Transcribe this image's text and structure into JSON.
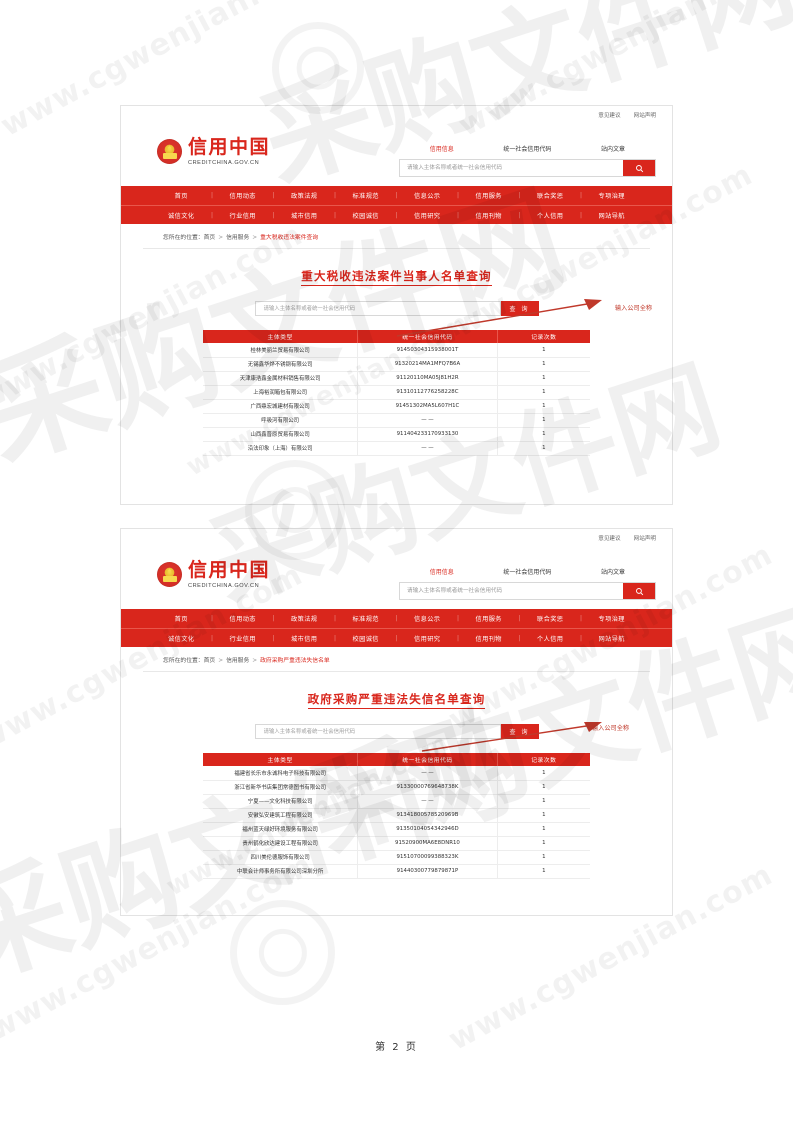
{
  "site": {
    "top_links": [
      "意见建议",
      "网站声明"
    ],
    "brand_cn": "信用中国",
    "brand_en": "CREDITCHINA.GOV.CN",
    "emblem_icon": "national-emblem-icon",
    "search": {
      "tabs": [
        "信用信息",
        "统一社会信用代码",
        "站内文章"
      ],
      "active_tab": "信用信息",
      "placeholder": "请输入主体名称或者统一社会信用代码",
      "button_icon": "search-icon"
    },
    "nav_row1": [
      "首页",
      "信用动态",
      "政策法规",
      "标准规范",
      "信息公示",
      "信用服务",
      "联合奖惩",
      "专项治理"
    ],
    "nav_row2": [
      "诚信文化",
      "行业信用",
      "城市信用",
      "校园诚信",
      "信用研究",
      "信用刊物",
      "个人信用",
      "网站导航"
    ]
  },
  "section1": {
    "breadcrumb": {
      "prefix": "您所在的位置：",
      "items": [
        "首页",
        "信用服务"
      ],
      "current": "重大税收违法案件查询",
      "separator": ">"
    },
    "title": "重大税收违法案件当事人名单查询",
    "query": {
      "placeholder": "请输入主体名称或者统一社会信用代码",
      "button_label": "查 询"
    },
    "annotation": "输入公司全称",
    "table": {
      "headers": [
        "主体类型",
        "统一社会信用代码",
        "记录次数"
      ],
      "rows": [
        [
          "桂林美丽兰贸易有限公司",
          "91450304315938001T",
          "1"
        ],
        [
          "无锡鑫华烨不锈钢有限公司",
          "91320214MA1MFQ7B6A",
          "1"
        ],
        [
          "天津康浩鑫金属材料销售有限公司",
          "91120110MA05J81H2R",
          "1"
        ],
        [
          "上海裕润箱包有限公司",
          "91310112776258228C",
          "1"
        ],
        [
          "广西鼎宏城建材有限公司",
          "91451302MA5L607H1C",
          "1"
        ],
        [
          "呼吸河有限公司",
          "— —",
          "1"
        ],
        [
          "山西鑫晋原贸易有限公司",
          "911404233170933130",
          "1"
        ],
        [
          "沿法印象（上海）有限公司",
          "— —",
          "1"
        ]
      ]
    }
  },
  "section2": {
    "breadcrumb": {
      "prefix": "您所在的位置：",
      "items": [
        "首页",
        "信用服务"
      ],
      "current": "政府采购严重违法失信名单",
      "separator": ">"
    },
    "title": "政府采购严重违法失信名单查询",
    "query": {
      "placeholder": "请输入主体名称或者统一社会信用代码",
      "button_label": "查 询"
    },
    "annotation": "输入公司全称",
    "table": {
      "headers": [
        "主体类型",
        "统一社会信用代码",
        "记录次数"
      ],
      "rows": [
        [
          "福建省长乐市永诚科电子科技有限公司",
          "— —",
          "1"
        ],
        [
          "浙江省新华书店集团常德图书有限公司",
          "91330000769648738K",
          "1"
        ],
        [
          "宁夏——文化科技有限公司",
          "— —",
          "1"
        ],
        [
          "安徽弘安建筑工程有限公司",
          "91341800578520969B",
          "1"
        ],
        [
          "福州蓝天绿好环境服务有限公司",
          "91350104054342946D",
          "1"
        ],
        [
          "贵州鹤化欣达建设工程有限公司",
          "91520900MA6E8DNR10",
          "1"
        ],
        [
          "四川美伦德服饰有限公司",
          "91510700099388323K",
          "1"
        ],
        [
          "中联会计师事务所有限公司深圳分所",
          "91440300779879871P",
          "1"
        ]
      ]
    }
  },
  "footer": {
    "page_label": "第 2 页"
  },
  "watermarks": {
    "url": "www.cgwenjian.com",
    "cn_big": "采购文件网",
    "cn_chars": [
      "采",
      "购",
      "文",
      "件",
      "网"
    ]
  },
  "colors": {
    "brand_red": "#d9261c",
    "header_red": "#d9261c",
    "annotation_red": "#c0392b",
    "text_dark": "#333333",
    "border_grey": "#ededed"
  }
}
